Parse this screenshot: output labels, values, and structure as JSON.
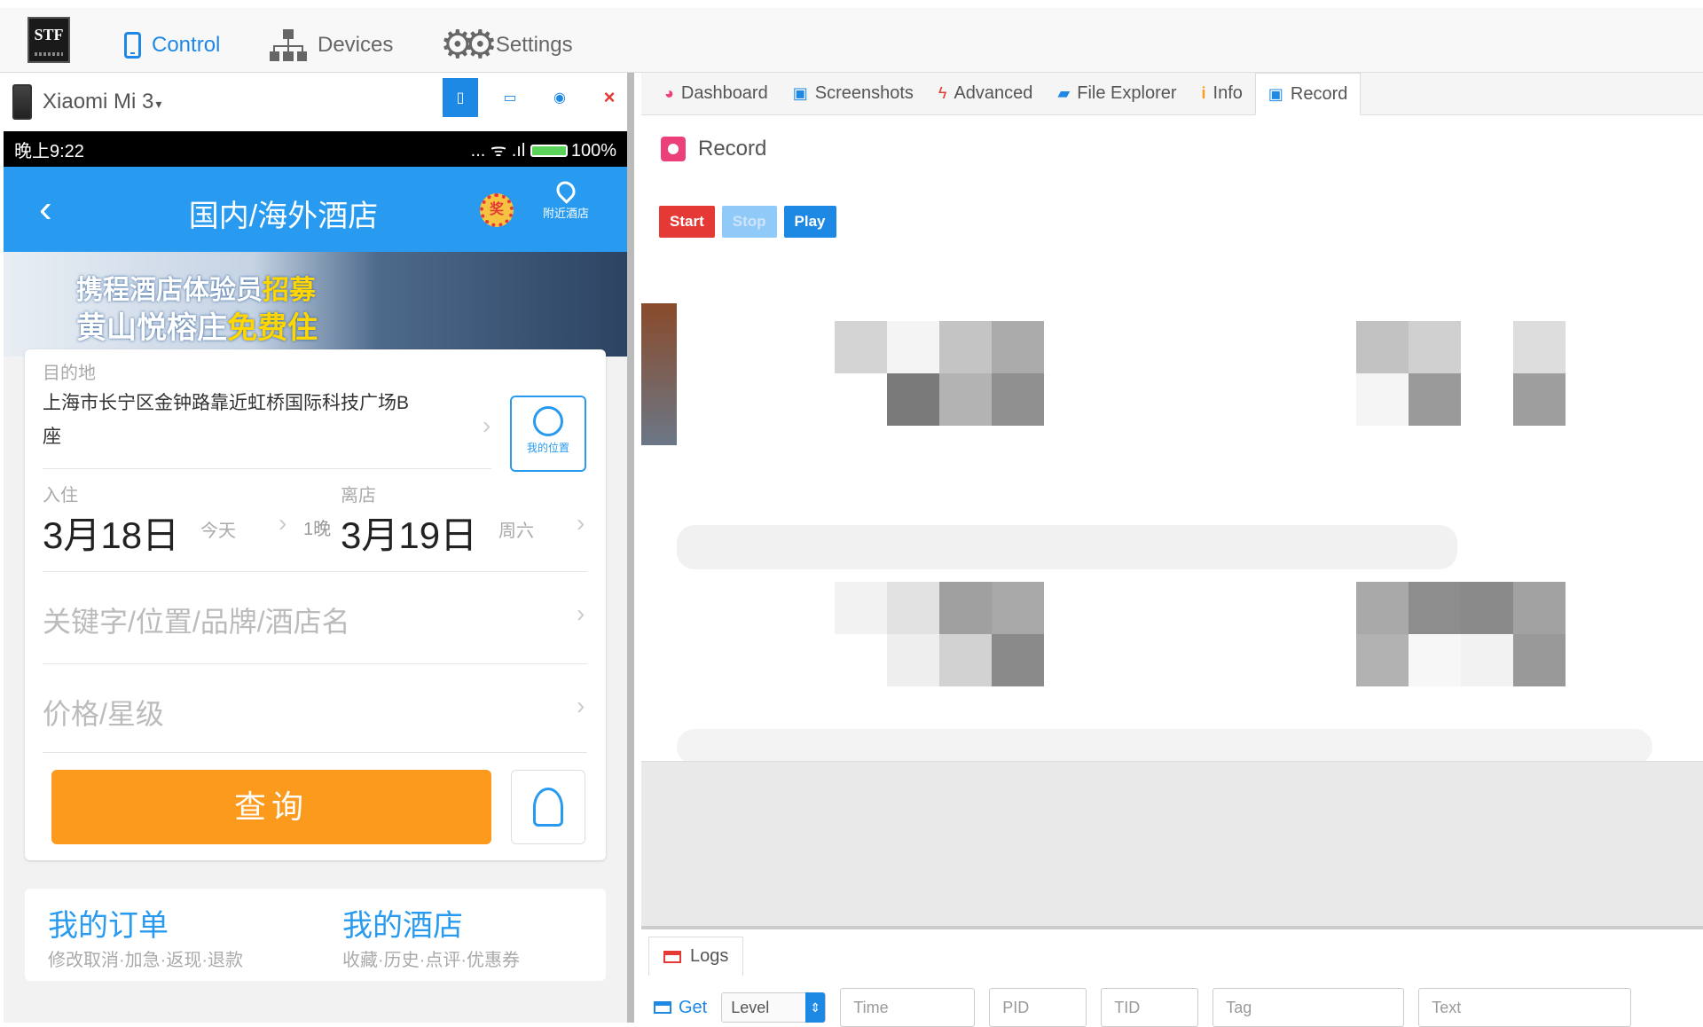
{
  "topnav": {
    "logo_text": "STF",
    "items": [
      {
        "label": "Control",
        "icon": "phone-icon",
        "active": true
      },
      {
        "label": "Devices",
        "icon": "network-tree-icon",
        "active": false
      },
      {
        "label": "Settings",
        "icon": "gears-icon",
        "active": false
      }
    ]
  },
  "device": {
    "name": "Xiaomi Mi 3",
    "caret": "▾",
    "controls": {
      "portrait": "▯",
      "landscape": "▭",
      "visibility": "◉",
      "close": "×"
    },
    "status": {
      "time": "晚上9:22",
      "signal": "... ᯤ .ıl",
      "battery": "100%"
    },
    "app": {
      "back": "‹",
      "title": "国内/海外酒店",
      "badge": "奖",
      "nearby_label": "附近酒店",
      "banner_line1_a": "携程酒店体验员",
      "banner_line1_b": "招募",
      "banner_line2_a": "黄山悦榕庄",
      "banner_line2_b": "免费住",
      "dest_label": "目的地",
      "dest_value": "上海市长宁区金钟路靠近虹桥国际科技广场B座",
      "my_location": "我的位置",
      "checkin_label": "入住",
      "checkin_date": "3月18日",
      "checkin_sub": "今天",
      "nights": "1晚",
      "checkout_label": "离店",
      "checkout_date": "3月19日",
      "checkout_sub": "周六",
      "keyword_placeholder": "关键字/位置/品牌/酒店名",
      "price_placeholder": "价格/星级",
      "search_button": "查询",
      "orders_title": "我的订单",
      "orders_sub": "修改取消·加急·返现·退款",
      "hotels_title": "我的酒店",
      "hotels_sub": "收藏·历史·点评·优惠券",
      "chevron": "›"
    }
  },
  "tabs": [
    {
      "label": "Dashboard",
      "icon": "dashboard-icon",
      "glyph": "◕",
      "color": "#ec407a",
      "active": false
    },
    {
      "label": "Screenshots",
      "icon": "camera-icon",
      "glyph": "▣",
      "color": "#1e88e5",
      "active": false
    },
    {
      "label": "Advanced",
      "icon": "bolt-icon",
      "glyph": "ϟ",
      "color": "#e53935",
      "active": false
    },
    {
      "label": "File Explorer",
      "icon": "folder-icon",
      "glyph": "▰",
      "color": "#1e88e5",
      "active": false
    },
    {
      "label": "Info",
      "icon": "info-icon",
      "glyph": "i",
      "color": "#fb9a1c",
      "active": false
    },
    {
      "label": "Record",
      "icon": "camera-icon",
      "glyph": "▣",
      "color": "#1e88e5",
      "active": true
    }
  ],
  "record": {
    "title": "Record",
    "start": "Start",
    "stop": "Stop",
    "play": "Play"
  },
  "logs": {
    "tab_label": "Logs",
    "get_label": "Get",
    "level_label": "Level",
    "time_placeholder": "Time",
    "pid_placeholder": "PID",
    "tid_placeholder": "TID",
    "tag_placeholder": "Tag",
    "text_placeholder": "Text"
  }
}
